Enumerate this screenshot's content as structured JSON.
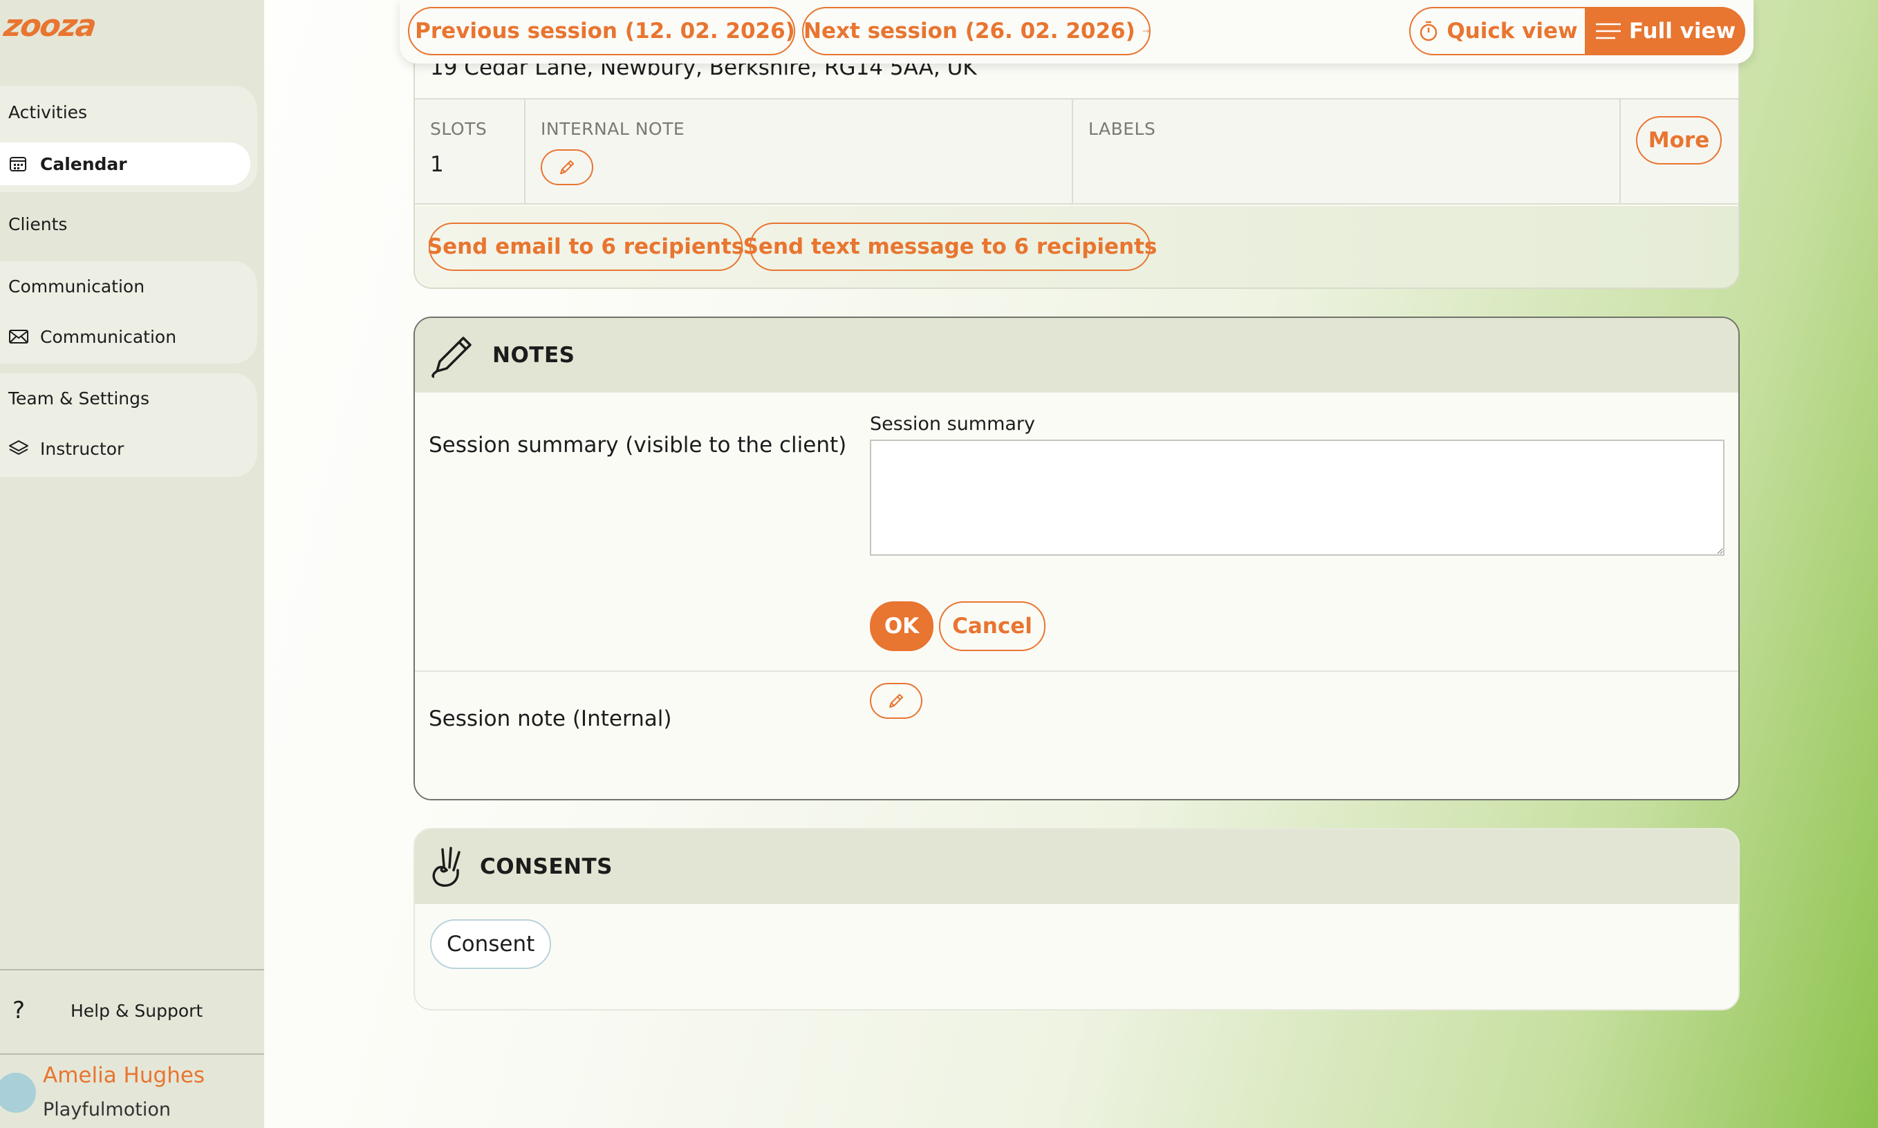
{
  "brand": {
    "logo_text": "zooza",
    "accent": "#e87530"
  },
  "sidebar": {
    "activities_heading": "Activities",
    "calendar": "Calendar",
    "clients": "Clients",
    "communication_heading": "Communication",
    "communication": "Communication",
    "team_heading": "Team & Settings",
    "instructor": "Instructor",
    "help": "Help & Support",
    "help_icon": "?",
    "user": {
      "name": "Amelia Hughes",
      "org": "Playfulmotion"
    }
  },
  "topbar": {
    "prev_session": "Previous session (12. 02. 2026)",
    "next_session": "Next session (26. 02. 2026)",
    "quick_view": "Quick view",
    "full_view": "Full view"
  },
  "session": {
    "address": "19 Cedar Lane, Newbury, Berkshire, RG14 5AA, UK",
    "slots_label": "SLOTS",
    "slots_value": "1",
    "internal_note_label": "INTERNAL NOTE",
    "labels_label": "LABELS",
    "more": "More",
    "send_email": "Send email to 6 recipients",
    "send_text": "Send text message to 6 recipients"
  },
  "notes": {
    "title": "NOTES",
    "summary_row_label": "Session summary (visible to the client)",
    "summary_field_label": "Session summary",
    "summary_value": "",
    "ok": "OK",
    "cancel": "Cancel",
    "internal_row_label": "Session note (Internal)"
  },
  "consents": {
    "title": "CONSENTS",
    "chip": "Consent"
  }
}
